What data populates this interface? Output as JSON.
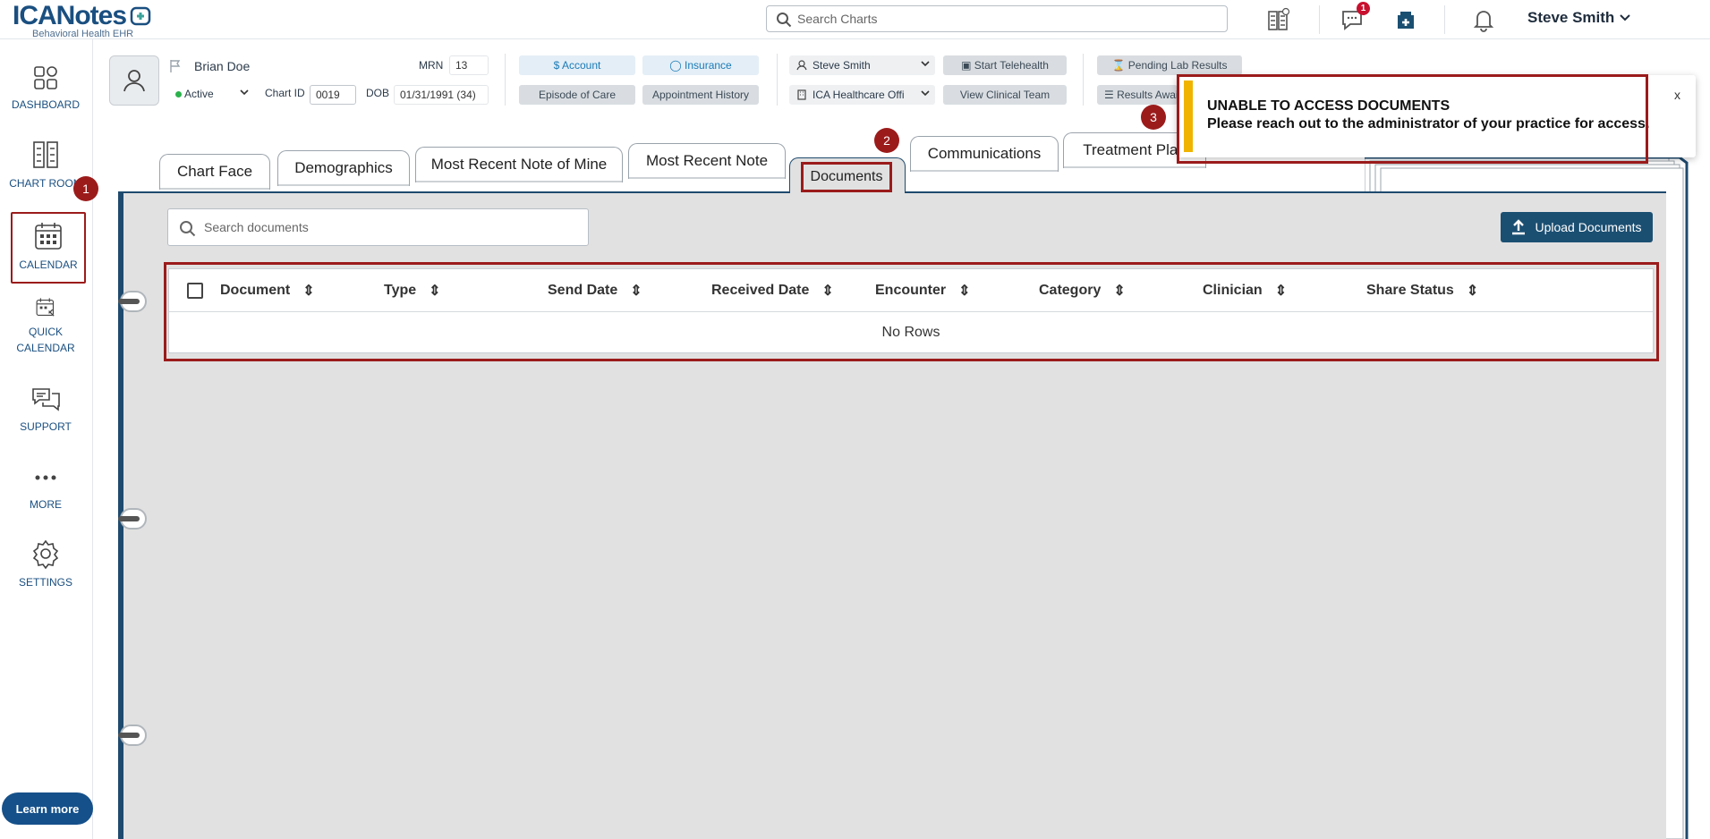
{
  "app": {
    "logo": "ICANotes",
    "logo_sub": "Behavioral Health EHR"
  },
  "topbar": {
    "search_placeholder": "Search Charts",
    "message_count": "1",
    "user_name": "Steve Smith"
  },
  "sidebar": {
    "items": [
      {
        "label": "DASHBOARD",
        "icon": "dashboard-icon"
      },
      {
        "label": "CHART ROOM",
        "icon": "file-cabinet-icon"
      },
      {
        "label": "CALENDAR",
        "icon": "calendar-icon"
      },
      {
        "label": "QUICK CALENDAR",
        "icon": "quick-calendar-icon"
      },
      {
        "label": "SUPPORT",
        "icon": "support-chat-icon"
      },
      {
        "label": "MORE",
        "icon": "more-dots-icon"
      },
      {
        "label": "SETTINGS",
        "icon": "gear-icon"
      }
    ],
    "learn_more": "Learn more"
  },
  "patient": {
    "name": "Brian Doe",
    "status": "Active",
    "mrn_label": "MRN",
    "mrn": "13",
    "chart_id_label": "Chart ID",
    "chart_id": "0019",
    "dob_label": "DOB",
    "dob": "01/31/1991 (34)"
  },
  "actions": {
    "account": "Account",
    "insurance": "Insurance",
    "episode": "Episode of Care",
    "appointments": "Appointment History",
    "clinician": "Steve Smith",
    "office": "ICA Healthcare Offi",
    "telehealth": "Start Telehealth",
    "clinical_team": "View Clinical Team",
    "pending_lab": "Pending Lab Results",
    "results_await": "Results Await"
  },
  "tabs": [
    "Chart Face",
    "Demographics",
    "Most Recent Note of Mine",
    "Most Recent Note",
    "Documents",
    "Communications",
    "Treatment Plan"
  ],
  "documents": {
    "search_placeholder": "Search documents",
    "upload_label": "Upload Documents",
    "columns": [
      "Document",
      "Type",
      "Send Date",
      "Received Date",
      "Encounter",
      "Category",
      "Clinician",
      "Share Status"
    ],
    "empty_text": "No Rows"
  },
  "toast": {
    "title": "UNABLE TO ACCESS DOCUMENTS",
    "message": "Please reach out to the administrator of your practice for access.",
    "close": "x"
  },
  "steps": [
    "1",
    "2",
    "3"
  ],
  "colors": {
    "brand": "#1a4f80",
    "highlight": "#9b1b1b",
    "warning": "#f0b400",
    "upload": "#1b4f72"
  }
}
